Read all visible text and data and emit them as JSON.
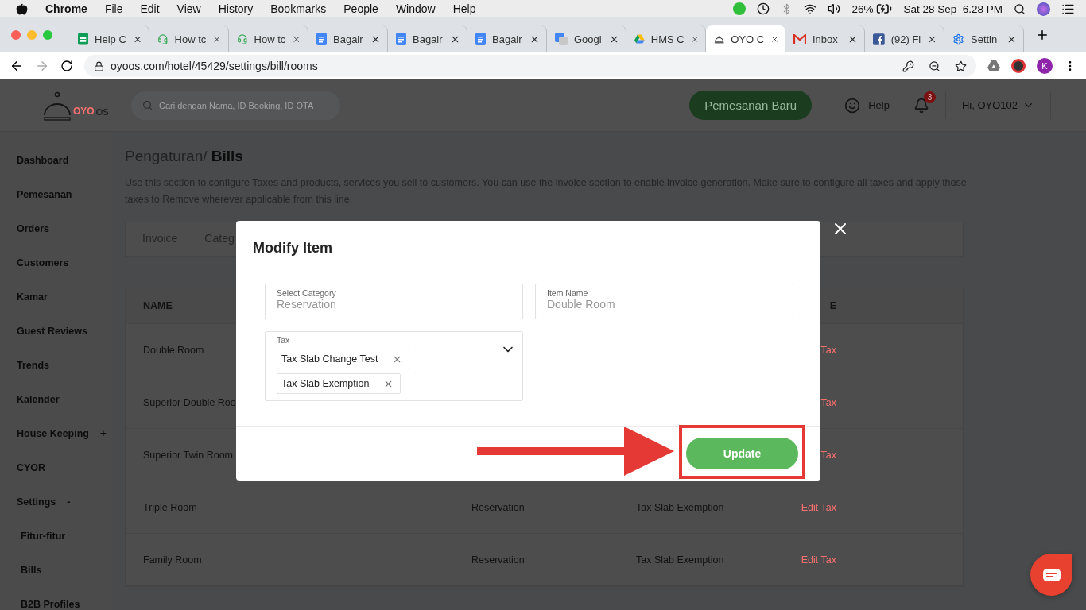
{
  "menubar": {
    "app": "Chrome",
    "menus": [
      "File",
      "Edit",
      "View",
      "History",
      "Bookmarks",
      "People",
      "Window",
      "Help"
    ],
    "battery": "26%",
    "clock": "Sat 28 Sep  6.28 PM"
  },
  "browser_tabs": [
    {
      "title": "Help C",
      "kind": "sheets",
      "selected": false
    },
    {
      "title": "How tc",
      "kind": "headset",
      "selected": false
    },
    {
      "title": "How tc",
      "kind": "headset",
      "selected": false
    },
    {
      "title": "Bagair",
      "kind": "docs",
      "selected": false
    },
    {
      "title": "Bagair",
      "kind": "docs",
      "selected": false
    },
    {
      "title": "Bagair",
      "kind": "docs",
      "selected": false
    },
    {
      "title": "Googl",
      "kind": "translate",
      "selected": false
    },
    {
      "title": "HMS C",
      "kind": "drive",
      "selected": false
    },
    {
      "title": "OYO C",
      "kind": "bell",
      "selected": true
    },
    {
      "title": "Inbox",
      "kind": "mail",
      "selected": false
    },
    {
      "title": "(92) Fi",
      "kind": "facebook",
      "selected": false
    },
    {
      "title": "Settin",
      "kind": "gear",
      "selected": false
    }
  ],
  "address_bar": {
    "url": "oyoos.com/hotel/45429/settings/bill/rooms",
    "profile": "K"
  },
  "header": {
    "logo": {
      "brand": "OYO",
      "suffix": "OS"
    },
    "search": {
      "placeholder": "Cari dengan Nama, ID Booking, ID OTA"
    },
    "new_booking": "Pemesanan Baru",
    "help": "Help",
    "notifications": "3",
    "user": "Hi, OYO102"
  },
  "sidebar": [
    {
      "label": "Dashboard"
    },
    {
      "label": "Pemesanan"
    },
    {
      "label": "Orders"
    },
    {
      "label": "Customers"
    },
    {
      "label": "Kamar"
    },
    {
      "label": "Guest Reviews"
    },
    {
      "label": "Trends"
    },
    {
      "label": "Kalender"
    },
    {
      "label": "House Keeping",
      "toggle": "+"
    },
    {
      "label": "CYOR"
    },
    {
      "label": "Settings",
      "toggle": "-",
      "children": [
        {
          "label": "Fitur-fitur"
        },
        {
          "label": "Bills"
        },
        {
          "label": "B2B Profiles"
        }
      ]
    }
  ],
  "page": {
    "breadcrumb": "Pengaturan/",
    "title": "Bills",
    "description": "Use this section to configure Taxes and products, services you sell to customers. You can use the invoice section to enable invoice generation. Make sure to configure all taxes and apply those taxes to Remove wherever applicable from this line.",
    "tabs": [
      {
        "label": "Invoice",
        "selected": false
      },
      {
        "label": "Categ",
        "selected": false
      }
    ],
    "table": {
      "columns": [
        "NAME",
        "E"
      ],
      "rows": [
        {
          "name": "Double Room",
          "action": "Tax"
        },
        {
          "name": "Superior Double Roo",
          "action": "Tax"
        },
        {
          "name": "Superior Twin Room",
          "action": "Tax"
        },
        {
          "name": "Triple Room",
          "category": "Reservation",
          "tax": "Tax Slab Exemption",
          "action": "Edit Tax"
        },
        {
          "name": "Family Room",
          "category": "Reservation",
          "tax": "Tax Slab Exemption",
          "action": "Edit Tax"
        }
      ]
    }
  },
  "modal": {
    "title": "Modify Item",
    "fields": [
      {
        "label": "Select Category",
        "value": "Reservation"
      },
      {
        "label": "Item Name",
        "value": "Double Room"
      }
    ],
    "tax": {
      "label": "Tax",
      "chips": [
        "Tax Slab Change Test",
        "Tax Slab Exemption"
      ]
    },
    "submit": "Update"
  }
}
